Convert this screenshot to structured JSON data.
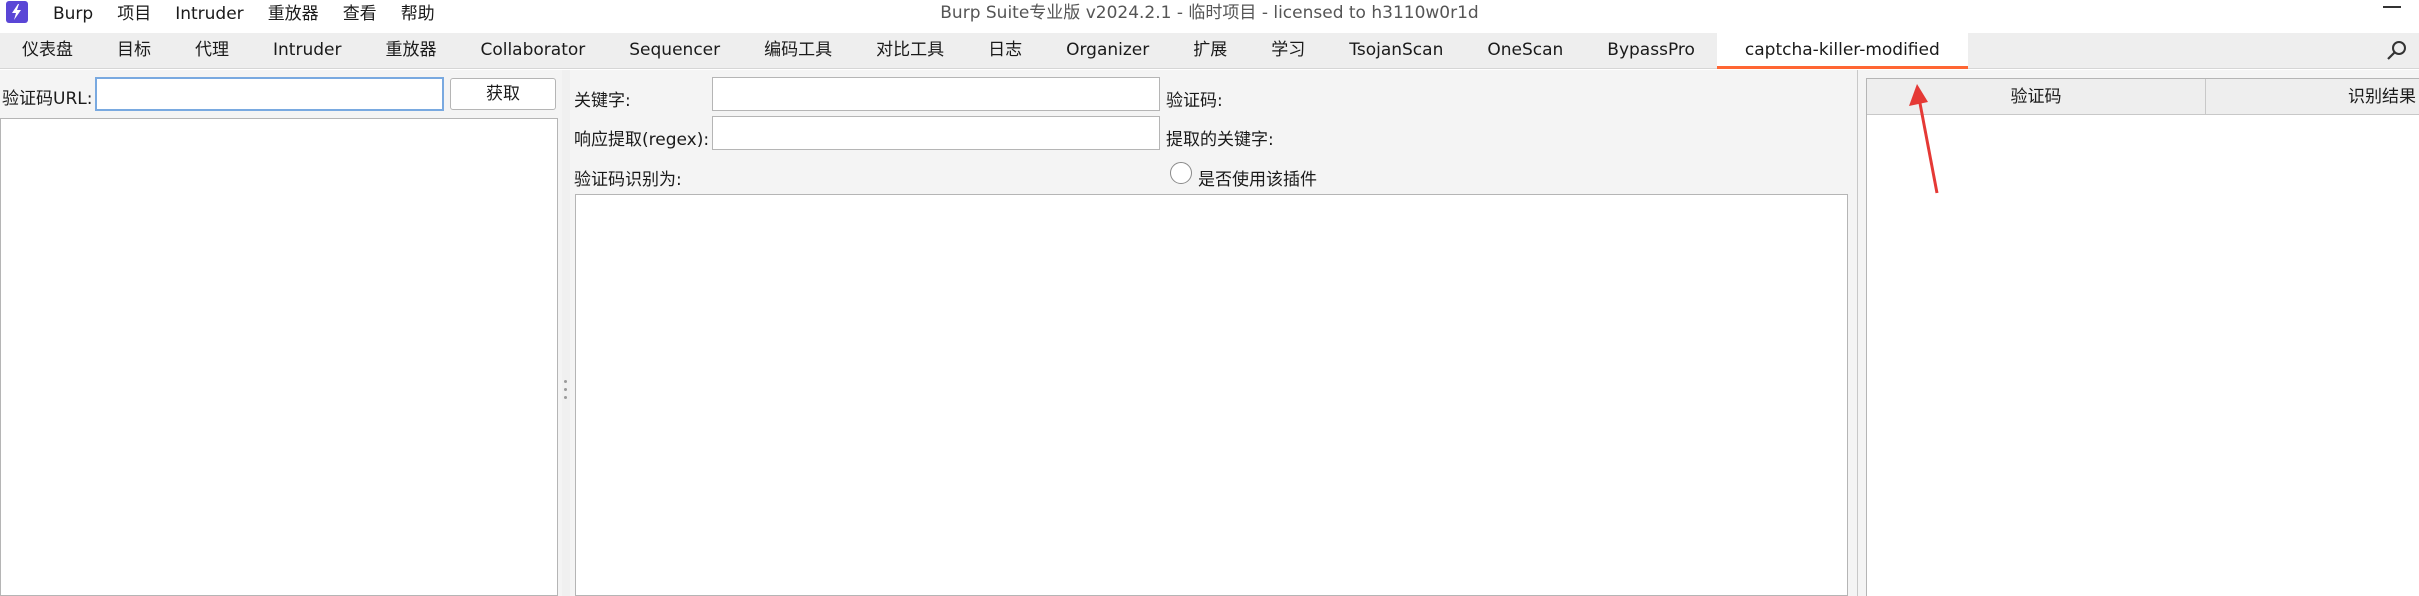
{
  "window": {
    "title": "Burp Suite专业版  v2024.2.1 - 临时项目 - licensed to h3110w0r1d",
    "logo_icon": "burp-lightning-logo",
    "brand_color": "#5a46d6"
  },
  "menubar": {
    "items": [
      {
        "label": "Burp"
      },
      {
        "label": "项目"
      },
      {
        "label": "Intruder"
      },
      {
        "label": "重放器"
      },
      {
        "label": "查看"
      },
      {
        "label": "帮助"
      }
    ]
  },
  "tabs": {
    "items": [
      {
        "label": "仪表盘"
      },
      {
        "label": "目标"
      },
      {
        "label": "代理"
      },
      {
        "label": "Intruder"
      },
      {
        "label": "重放器"
      },
      {
        "label": "Collaborator"
      },
      {
        "label": "Sequencer"
      },
      {
        "label": "编码工具"
      },
      {
        "label": "对比工具"
      },
      {
        "label": "日志"
      },
      {
        "label": "Organizer"
      },
      {
        "label": "扩展"
      },
      {
        "label": "学习"
      },
      {
        "label": "TsojanScan"
      },
      {
        "label": "OneScan"
      },
      {
        "label": "BypassPro"
      },
      {
        "label": "captcha-killer-modified"
      }
    ],
    "active": "captcha-killer-modified",
    "active_color": "#ff6633",
    "search_icon": "search-icon"
  },
  "left_panel": {
    "url_label": "验证码URL:",
    "url_value": "",
    "fetch_label": "获取"
  },
  "middle_panel": {
    "keyword_label": "关键字:",
    "keyword_value": "",
    "captcha_label": "验证码:",
    "regex_label": "响应提取(regex):",
    "regex_value": "",
    "extracted_keyword_label": "提取的关键字:",
    "recognized_as_label": "验证码识别为:",
    "use_plugin_label": "是否使用该插件",
    "use_plugin_checked": false
  },
  "right_panel": {
    "columns": [
      "验证码",
      "识别结果"
    ]
  },
  "annotation": {
    "arrow_color": "#e53935"
  }
}
